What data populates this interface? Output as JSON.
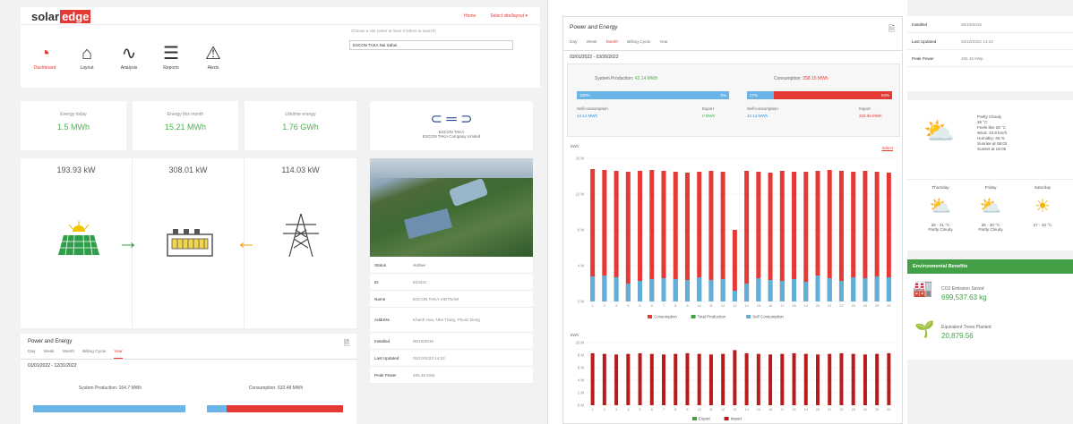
{
  "left": {
    "logo_solar": "solar",
    "logo_edge": "edge",
    "nav_home": "Home",
    "nav_site": "Select site/layout",
    "icons": [
      {
        "label": "Dashboard",
        "glyph": "◔",
        "active": true
      },
      {
        "label": "Layout",
        "glyph": "⌂"
      },
      {
        "label": "Analysis",
        "glyph": "∿"
      },
      {
        "label": "Reports",
        "glyph": "☰"
      },
      {
        "label": "Alerts",
        "glyph": "⚠"
      }
    ],
    "search_hint": "Choose a site (enter at least 3 letters to search)",
    "search_value": "ESCON TAKA Nai Sahai",
    "stats": [
      {
        "title": "Energy today",
        "value": "1.5 MWh"
      },
      {
        "title": "Energy this month",
        "value": "15.21 MWh"
      },
      {
        "title": "Lifetime energy",
        "value": "1.76 GWh"
      }
    ],
    "flow": {
      "solar_kw": "193.93 kW",
      "load_kw": "308.01 kW",
      "grid_kw": "114.03 kW"
    },
    "company_line1": "ESCON TAKA",
    "company_line2": "ESCON TAKA Company Limited",
    "info": [
      {
        "k": "Status",
        "v": "Active"
      },
      {
        "k": "ID",
        "v": "933331"
      },
      {
        "k": "Name",
        "v": "ESCON TAKA-VIETNAM"
      },
      {
        "k": "Address",
        "v": "Khanh Hoa, Nha Trang, Phuoc Dong"
      },
      {
        "k": "Installed",
        "v": "05/19/2016"
      },
      {
        "k": "Last Updated",
        "v": "03/10/2022 14:32"
      },
      {
        "k": "Peak Power",
        "v": "455.45 kWp"
      }
    ],
    "pe_title": "Power and Energy",
    "pe_tabs": [
      "Day",
      "Week",
      "Month",
      "Billing Cycle",
      "Year"
    ],
    "pe_range": "01/01/2022 - 12/31/2022",
    "pe_prod": "System Production: 164.7 MWh",
    "pe_cons": "Consumption: 632.48 MWh"
  },
  "mid": {
    "title": "Power and Energy",
    "tabs": [
      "Day",
      "Week",
      "Month",
      "Billing Cycle",
      "Year"
    ],
    "range": "03/01/2022 - 03/26/2022",
    "prod_label": "System Production:",
    "prod_value": "42.14 MWh",
    "cons_label": "Consumption:",
    "cons_value": "258.15 MWh",
    "bar1_pct": "100%",
    "bar1_pct_r": "0%",
    "bar2_pct": "17%",
    "bar2_pct_r": "83%",
    "self_cons": "Self-consumption",
    "self_cons_val": "42.14 MWh",
    "export": "Export",
    "export_val": "0 MWh",
    "self_cons2": "Self-consumption",
    "self_cons2_val": "42.14 MWh",
    "import": "Import",
    "import_val": "216.06 MWh",
    "unit": "kWh",
    "select_link": "Select",
    "legend": [
      "Consumption",
      "Total Production",
      "Self Consumption"
    ],
    "legend2": [
      "Export",
      "Import"
    ],
    "yticks": [
      "16 M",
      "12 M",
      "8 M",
      "4 M",
      "0 M"
    ],
    "yticks2": [
      "10 M",
      "8 M",
      "6 M",
      "4 M",
      "2 M",
      "0 M"
    ],
    "unit2": "kWh"
  },
  "right": {
    "info": [
      {
        "k": "Installed",
        "v": "05/19/2016"
      },
      {
        "k": "Last Updated",
        "v": "03/10/2022 14:32"
      },
      {
        "k": "Peak Power",
        "v": "455.45 kWp"
      }
    ],
    "weather_now": "Partly Cloudy",
    "weather_temp": "26 °C",
    "weather_feels": "Feels like 28 °C",
    "weather_wind": "Wind: 10.8 km/h",
    "weather_hum": "Humidity: 65 %",
    "weather_sunrise": "Sunrise at 06:02",
    "weather_sunset": "Sunset at 18:05",
    "forecast": [
      {
        "day": "Thursday",
        "temp": "26 - 31 °C",
        "cond": "Partly Cloudy"
      },
      {
        "day": "Friday",
        "temp": "25 - 30 °C",
        "cond": "Partly Cloudy"
      },
      {
        "day": "Saturday",
        "temp": "27 - 33 °C",
        "cond": ""
      }
    ],
    "env_title": "Environmental Benefits",
    "co2_label": "CO2 Emission Saved",
    "co2_value": "699,537.63 kg",
    "trees_label": "Equivalent Trees Planted",
    "trees_value": "20,879.56"
  },
  "chart_data": [
    {
      "type": "bar",
      "title": "",
      "ylabel": "kWh",
      "ylim": [
        0,
        16000000
      ],
      "categories": [
        "1",
        "2",
        "3",
        "4",
        "5",
        "6",
        "7",
        "8",
        "9",
        "10",
        "11",
        "12",
        "13",
        "14",
        "15",
        "16",
        "17",
        "18",
        "19",
        "20",
        "21",
        "22",
        "23",
        "24",
        "25",
        "26"
      ],
      "series": [
        {
          "name": "Consumption",
          "values": [
            14800000,
            14700000,
            14600000,
            14500000,
            14600000,
            14700000,
            14600000,
            14500000,
            14400000,
            14500000,
            14600000,
            14500000,
            8000000,
            14600000,
            14500000,
            14400000,
            14600000,
            14500000,
            14500000,
            14600000,
            14700000,
            14600000,
            14500000,
            14600000,
            14500000,
            14400000
          ]
        },
        {
          "name": "Self Consumption",
          "values": [
            2800000,
            2900000,
            2700000,
            2000000,
            2300000,
            2500000,
            2600000,
            2500000,
            2400000,
            2700000,
            2400000,
            2500000,
            1200000,
            2000000,
            2600000,
            2400000,
            2300000,
            2500000,
            2200000,
            2900000,
            2600000,
            2300000,
            2700000,
            2600000,
            2800000,
            2700000
          ]
        }
      ]
    },
    {
      "type": "bar",
      "title": "",
      "ylabel": "kWh",
      "ylim": [
        0,
        10000000
      ],
      "categories": [
        "1",
        "2",
        "3",
        "4",
        "5",
        "6",
        "7",
        "8",
        "9",
        "10",
        "11",
        "12",
        "13",
        "14",
        "15",
        "16",
        "17",
        "18",
        "19",
        "20",
        "21",
        "22",
        "23",
        "24",
        "25",
        "26"
      ],
      "series": [
        {
          "name": "Export",
          "values": [
            0,
            0,
            0,
            0,
            0,
            0,
            0,
            0,
            0,
            0,
            0,
            0,
            0,
            0,
            0,
            0,
            0,
            0,
            0,
            0,
            0,
            0,
            0,
            0,
            0,
            0
          ]
        },
        {
          "name": "Import",
          "values": [
            8300000,
            8200000,
            8100000,
            8200000,
            8300000,
            8200000,
            8100000,
            8200000,
            8300000,
            8200000,
            8100000,
            8200000,
            8800000,
            8300000,
            8200000,
            8100000,
            8200000,
            8300000,
            8200000,
            8100000,
            8200000,
            8300000,
            8200000,
            8100000,
            8200000,
            8300000
          ]
        }
      ]
    }
  ]
}
